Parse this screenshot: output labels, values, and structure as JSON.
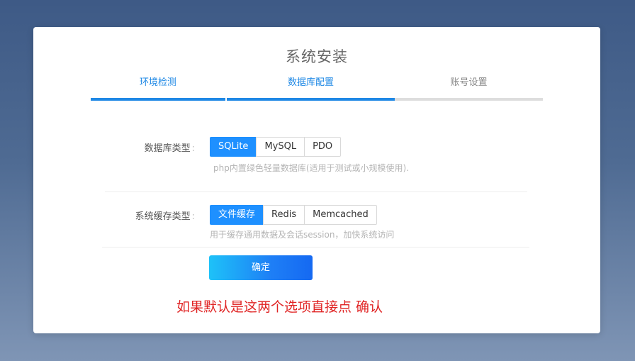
{
  "page": {
    "title": "系统安装"
  },
  "steps": [
    {
      "label": "环境检测",
      "state": "done"
    },
    {
      "label": "数据库配置",
      "state": "done"
    },
    {
      "label": "账号设置",
      "state": "pending"
    }
  ],
  "db_type": {
    "label": "数据库类型",
    "colon": ":",
    "options": [
      "SQLite",
      "MySQL",
      "PDO"
    ],
    "selected": "SQLite",
    "hint": "php内置绿色轻量数据库(适用于测试或小规模使用)."
  },
  "cache_type": {
    "label": "系统缓存类型",
    "colon": ":",
    "options": [
      "文件缓存",
      "Redis",
      "Memcached"
    ],
    "selected": "文件缓存",
    "hint": "用于缓存通用数据及会话session，加快系统访问"
  },
  "confirm_button": {
    "label": "确定"
  },
  "annotation": {
    "text": "如果默认是这两个选项直接点 确认",
    "color": "#e02424"
  },
  "colors": {
    "accent": "#1e90ff",
    "step_done": "#1e88e5",
    "step_pending": "#dddddd"
  }
}
